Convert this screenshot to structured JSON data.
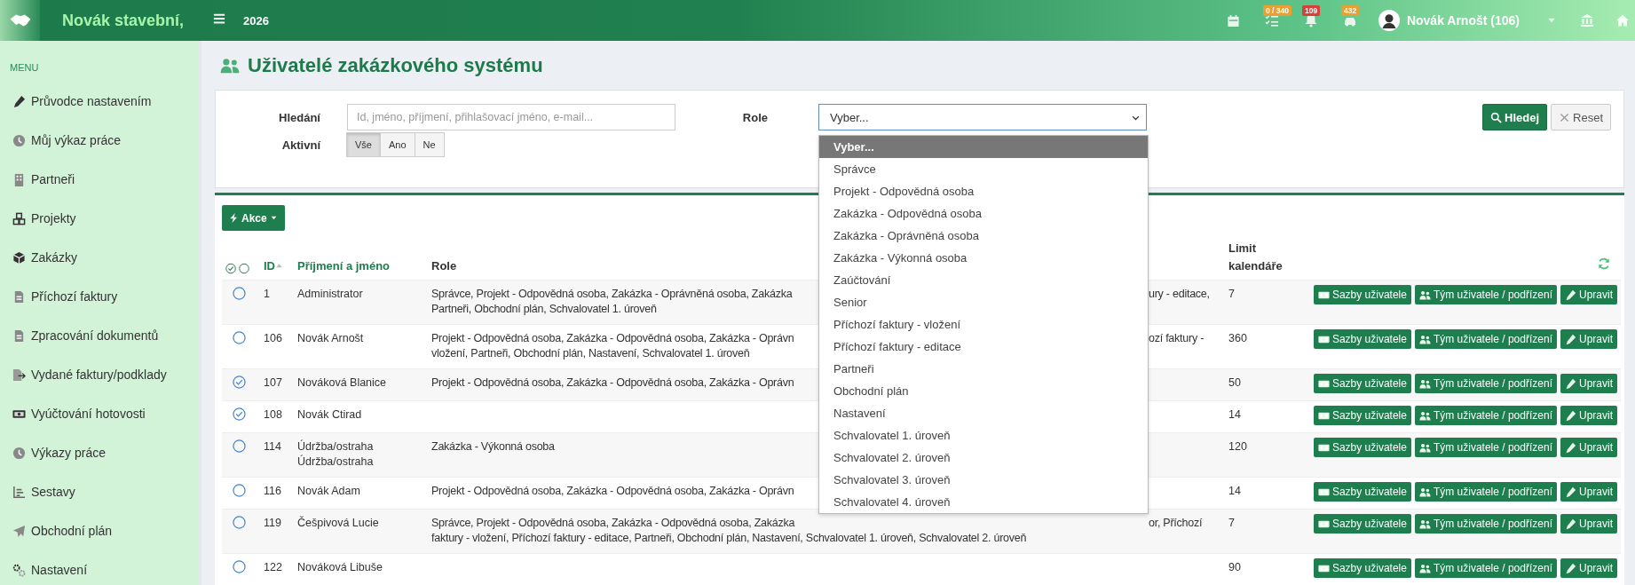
{
  "topbar": {
    "brand": "Novák stavební,",
    "year": "2026",
    "indicators": [
      {
        "badge": "0 / 340",
        "color": "#e8a032"
      },
      {
        "badge": "109",
        "color": "#d9403a"
      },
      {
        "badge": "432",
        "color": "#e8a032"
      }
    ],
    "user": "Novák Arnošt (106)"
  },
  "sidebar": {
    "heading": "MENU",
    "items": [
      "Průvodce nastavením",
      "Můj výkaz práce",
      "Partneři",
      "Projekty",
      "Zakázky",
      "Příchozí faktury",
      "Zpracování dokumentů",
      "Vydané faktury/podklady",
      "Vyúčtování hotovosti",
      "Výkazy práce",
      "Sestavy",
      "Obchodní plán",
      "Nastavení"
    ]
  },
  "page": {
    "title": "Uživatelé zakázkového systému"
  },
  "filters": {
    "search": {
      "label": "Hledání",
      "placeholder": "Id, jméno, příjmení, přihlašovací jméno, e-mail..."
    },
    "role": {
      "label": "Role",
      "value": "Vyber...",
      "expanded": true,
      "options": [
        {
          "label": "Vyber...",
          "selected": true
        },
        {
          "label": "Správce",
          "selected": false
        },
        {
          "label": "Projekt - Odpovědná osoba",
          "selected": false
        },
        {
          "label": "Zakázka - Odpovědná osoba",
          "selected": false
        },
        {
          "label": "Zakázka - Oprávněná osoba",
          "selected": false
        },
        {
          "label": "Zakázka - Výkonná osoba",
          "selected": false
        },
        {
          "label": "Zaúčtování",
          "selected": false
        },
        {
          "label": "Senior",
          "selected": false
        },
        {
          "label": "Příchozí faktury - vložení",
          "selected": false
        },
        {
          "label": "Příchozí faktury - editace",
          "selected": false
        },
        {
          "label": "Partneři",
          "selected": false
        },
        {
          "label": "Obchodní plán",
          "selected": false
        },
        {
          "label": "Nastavení",
          "selected": false
        },
        {
          "label": "Schvalovatel 1. úroveň",
          "selected": false
        },
        {
          "label": "Schvalovatel 2. úroveň",
          "selected": false
        },
        {
          "label": "Schvalovatel 3. úroveň",
          "selected": false
        },
        {
          "label": "Schvalovatel 4. úroveň",
          "selected": false
        }
      ]
    },
    "active": {
      "label": "Aktivní",
      "options": [
        {
          "label": "Vše",
          "selected": true
        },
        {
          "label": "Ano",
          "selected": false
        },
        {
          "label": "Ne",
          "selected": false
        }
      ]
    },
    "buttons": [
      {
        "label": "Hledej",
        "kind": "primary"
      },
      {
        "label": "Reset",
        "kind": "secondary"
      }
    ]
  },
  "table": {
    "action_button": "Akce",
    "columns": [
      {
        "label": "ID",
        "sortable": true,
        "sorted": true
      },
      {
        "label": "Příjmení a jméno",
        "sortable": true,
        "sorted": false
      },
      {
        "label": "Role",
        "sortable": false,
        "sorted": false
      },
      {
        "label": "Limit kalendáře",
        "sortable": false,
        "sorted": false
      }
    ],
    "rows": [
      {
        "selected": false,
        "id": "1",
        "name": "Administrator",
        "role": [
          {
            "text": "Správce, Projekt - Odpovědná osoba, Zakázka - Oprávněná osoba, Zakázka",
            "after_menu": "ury - editace,"
          },
          {
            "text": "Partneři, Obchodní plán, Schvalovatel 1. úroveň"
          }
        ],
        "limit": "7",
        "buttons": [
          "Sazby uživatele",
          "Tým uživatele / podřízení",
          "Upravit"
        ]
      },
      {
        "selected": false,
        "id": "106",
        "name": "Novák Arnošt",
        "role": [
          {
            "text": "Projekt - Odpovědná osoba, Zakázka - Odpovědná osoba, Zakázka - Oprávn",
            "after_menu": "ozí faktury -"
          },
          {
            "text": "vložení, Partneři, Obchodní plán, Nastavení, Schvalovatel 1. úroveň"
          }
        ],
        "limit": "360",
        "buttons": [
          "Sazby uživatele",
          "Tým uživatele / podřízení",
          "Upravit"
        ]
      },
      {
        "selected": true,
        "id": "107",
        "name": "Nováková Blanice",
        "role": [
          {
            "text": "Projekt - Odpovědná osoba, Zakázka - Odpovědná osoba, Zakázka - Oprávn"
          }
        ],
        "limit": "50",
        "buttons": [
          "Sazby uživatele",
          "Tým uživatele / podřízení",
          "Upravit"
        ]
      },
      {
        "selected": true,
        "id": "108",
        "name": "Novák Ctirad",
        "limit": "14",
        "buttons": [
          "Sazby uživatele",
          "Tým uživatele / podřízení",
          "Upravit"
        ]
      },
      {
        "selected": false,
        "id": "114",
        "name": "Údržba/ostraha Údržba/ostraha",
        "role": [
          {
            "text": "Zakázka - Výkonná osoba"
          }
        ],
        "limit": "120",
        "buttons": [
          "Sazby uživatele",
          "Tým uživatele / podřízení",
          "Upravit"
        ]
      },
      {
        "selected": false,
        "id": "116",
        "name": "Novák Adam",
        "role": [
          {
            "text": "Projekt - Odpovědná osoba, Zakázka - Odpovědná osoba, Zakázka - Oprávn"
          }
        ],
        "limit": "14",
        "buttons": [
          "Sazby uživatele",
          "Tým uživatele / podřízení",
          "Upravit"
        ]
      },
      {
        "selected": false,
        "id": "119",
        "name": "Češpivová Lucie",
        "role": [
          {
            "text": "Správce, Projekt - Odpovědná osoba, Zakázka - Odpovědná osoba, Zakázka",
            "after_menu": "or, Příchozí"
          },
          {
            "text": "faktury - vložení, Příchozí faktury - editace, Partneři, Obchodní plán, Nastavení, Schvalovatel 1. úroveň, Schvalovatel 2. úroveň"
          }
        ],
        "limit": "7",
        "buttons": [
          "Sazby uživatele",
          "Tým uživatele / podřízení",
          "Upravit"
        ]
      },
      {
        "selected": false,
        "id": "122",
        "name": "Nováková Libuše",
        "limit": "90",
        "buttons": [
          "Sazby uživatele",
          "Tým uživatele / podřízení",
          "Upravit"
        ]
      }
    ]
  }
}
